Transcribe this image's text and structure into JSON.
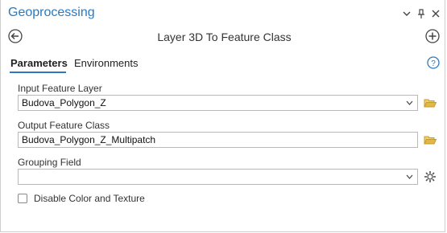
{
  "pane": {
    "title": "Geoprocessing",
    "icons": [
      "chevron-down-icon",
      "pin-icon",
      "close-icon"
    ]
  },
  "tool": {
    "title": "Layer 3D To Feature Class",
    "back_icon": "back-arrow-icon",
    "add_icon": "add-icon"
  },
  "tabs": [
    {
      "label": "Parameters",
      "active": true
    },
    {
      "label": "Environments",
      "active": false
    }
  ],
  "help_icon": "help-icon",
  "fields": {
    "input_layer": {
      "label": "Input Feature Layer",
      "value": "Budova_Polygon_Z"
    },
    "output_class": {
      "label": "Output Feature Class",
      "value": "Budova_Polygon_Z_Multipatch"
    },
    "grouping": {
      "label": "Grouping Field",
      "value": ""
    }
  },
  "checkbox": {
    "label": "Disable Color and Texture",
    "checked": false
  },
  "colors": {
    "accent": "#2b79c2",
    "folder": "#e0b84a"
  }
}
